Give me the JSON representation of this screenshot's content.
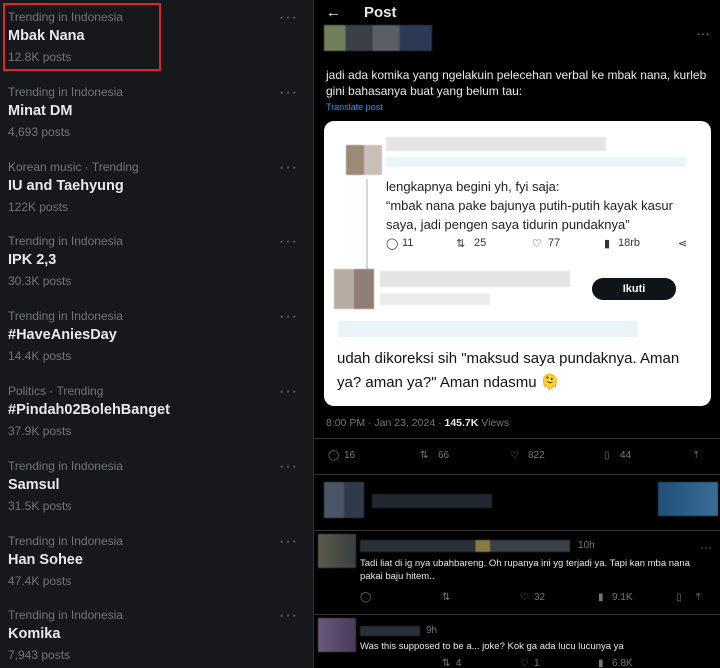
{
  "trends": [
    {
      "category": "Trending in Indonesia",
      "name": "Mbak Nana",
      "count": "12.8K posts"
    },
    {
      "category": "Trending in Indonesia",
      "name": "Minat DM",
      "count": "4,693 posts"
    },
    {
      "category": "Korean music · Trending",
      "name": "IU and Taehyung",
      "count": "122K posts"
    },
    {
      "category": "Trending in Indonesia",
      "name": "IPK 2,3",
      "count": "30.3K posts"
    },
    {
      "category": "Trending in Indonesia",
      "name": "#HaveAniesDay",
      "count": "14.4K posts"
    },
    {
      "category": "Politics · Trending",
      "name": "#Pindah02BolehBanget",
      "count": "37.9K posts"
    },
    {
      "category": "Trending in Indonesia",
      "name": "Samsul",
      "count": "31.5K posts"
    },
    {
      "category": "Trending in Indonesia",
      "name": "Han Sohee",
      "count": "47.4K posts"
    },
    {
      "category": "Trending in Indonesia",
      "name": "Komika",
      "count": "7,943 posts"
    }
  ],
  "more_glyph": "···",
  "post": {
    "back": "←",
    "title": "Post",
    "text": "jadi ada komika yang ngelakuin pelecehan verbal ke mbak nana, kurleb gini bahasanya buat yang belum tau:",
    "translate": "Translate post",
    "quote": {
      "text": "lengkapnya begini yh, fyi saja:\n“mbak nana pake bajunya putih-putih kayak kasur saya, jadi pengen saya tidurin pundaknya”",
      "replies": "11",
      "reposts": "25",
      "likes": "77",
      "views": "18rb",
      "follow": "Ikuti",
      "body": "udah dikoreksi sih \"maksud saya pundaknya. Aman ya? aman ya?\" Aman ndasmu 🫠"
    },
    "time": "8:00 PM · Jan 23, 2024 · ",
    "views_count": "145.7K",
    "views_label": " Views",
    "stats": {
      "replies": "16",
      "reposts": "66",
      "likes": "822",
      "bookmarks": "44"
    }
  },
  "replies": [
    {
      "time": "10h",
      "text": "Tadi liat di ig nya ubahbareng. Oh rupanya ini yg terjadi ya. Tapi kan mba nana pakai baju hitem..",
      "likes": "32",
      "views": "9.1K"
    },
    {
      "time": "9h",
      "text": "Was this supposed to be a... joke? Kok ga ada lucu lucunya ya",
      "reposts": "4",
      "likes": "1",
      "views": "6.8K"
    }
  ]
}
